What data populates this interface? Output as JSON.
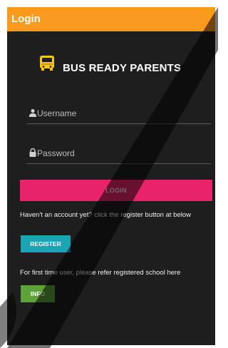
{
  "appbar": {
    "title": "Login"
  },
  "brand": {
    "title": "BUS READY PARENTS",
    "icon": "bus-icon"
  },
  "form": {
    "username_placeholder": "Username",
    "password_placeholder": "Password",
    "username_icon": "person-icon",
    "password_icon": "lock-icon"
  },
  "login": {
    "label": "LOGIN"
  },
  "register": {
    "prompt": "Haven't an account yet? click the register button at below",
    "label": "REGISTER"
  },
  "info": {
    "prompt": "For first time user, please refer registered school here",
    "label": "INFO"
  },
  "colors": {
    "appbar": "#f79a1e",
    "background": "#1e1e1e",
    "login_button": "#e8236a",
    "register_button": "#1ba4b3",
    "info_button": "#5ea33a"
  }
}
